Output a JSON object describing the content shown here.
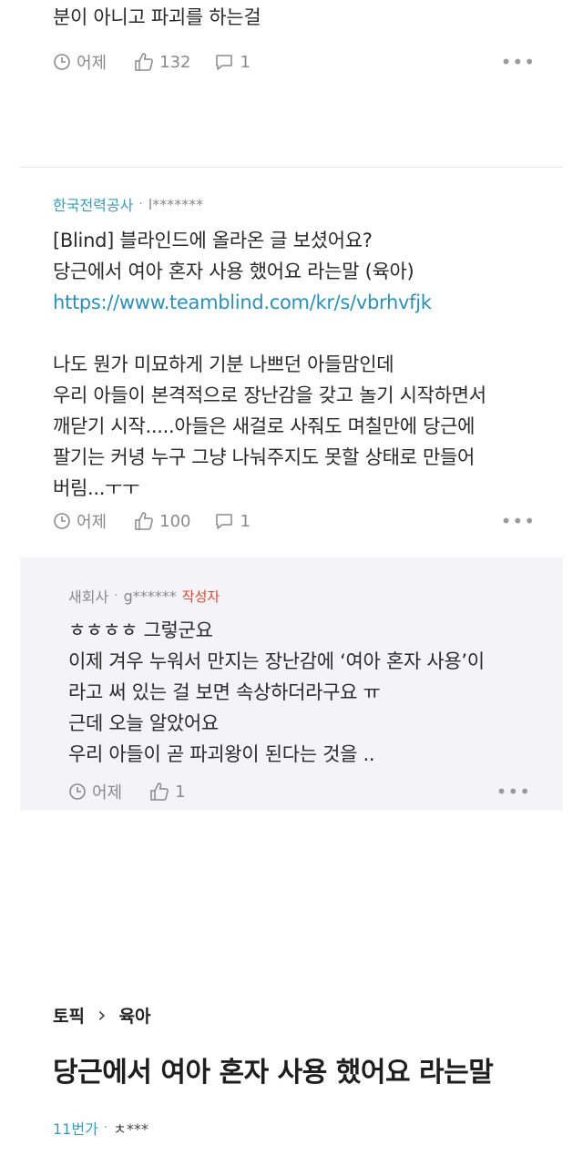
{
  "comment1": {
    "text_tail": "분이 아니고 파괴를 하는걸",
    "time": "어제",
    "likes": "132",
    "replies": "1"
  },
  "comment2": {
    "company": "한국전력공사",
    "user": "l*******",
    "lines": [
      "[Blind] 블라인드에 올라온 글 보셨어요?",
      "당근에서 여아 혼자 사용 했어요 라는말 (육아)"
    ],
    "link": "https://www.teamblind.com/kr/s/vbrhvfjk",
    "para": [
      "나도 뭔가 미묘하게 기분 나쁘던 아들맘인데",
      "우리 아들이 본격적으로 장난감을 갖고 놀기 시작하면서",
      "깨닫기 시작.....아들은 새걸로 사줘도 며칠만에 당근에",
      "팔기는 커녕 누구 그냥 나눠주지도 못할 상태로 만들어",
      "버림...ㅜㅜ"
    ],
    "time": "어제",
    "likes": "100",
    "replies": "1"
  },
  "reply": {
    "company": "새회사",
    "user": "g******",
    "author_tag": "작성자",
    "lines": [
      "ㅎㅎㅎㅎ 그렇군요",
      "이제 겨우 누워서 만지는 장난감에 ‘여아 혼자 사용’이",
      "라고 써 있는 걸 보면 속상하더라구요 ㅠ",
      "근데 오늘 알았어요",
      "우리 아들이 곧 파괴왕이 된다는 것을 .."
    ],
    "time": "어제",
    "likes": "1"
  },
  "post": {
    "breadcrumb_topic": "토픽",
    "breadcrumb_sep": "›",
    "breadcrumb_category": "육아",
    "title": "당근에서 여아 혼자 사용 했어요 라는말",
    "company": "11번가",
    "user": "ㅊ***"
  },
  "icons": {
    "clock": "clock-icon",
    "like": "thumbs-up-icon",
    "comment": "comment-icon",
    "more": "more-icon"
  },
  "colors": {
    "link": "#2f8fb0",
    "company": "#3a9bb8",
    "author_tag": "#d24a3a",
    "reply_bg": "#f4f4f6"
  }
}
